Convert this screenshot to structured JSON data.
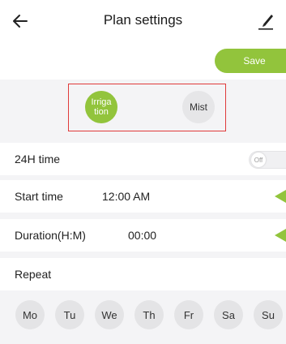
{
  "header": {
    "title": "Plan settings",
    "back_icon": "arrow-left-icon",
    "edit_icon": "pencil-icon"
  },
  "save": {
    "label": "Save"
  },
  "modes": {
    "items": [
      {
        "label": "Irriga\ntion",
        "selected": true
      },
      {
        "label": "Mist",
        "selected": false
      }
    ]
  },
  "settings": {
    "time24": {
      "label": "24H time",
      "toggle_text": "Off"
    },
    "start_time": {
      "label": "Start time",
      "value": "12:00 AM"
    },
    "duration": {
      "label": "Duration(H:M)",
      "value": "00:00"
    },
    "repeat": {
      "label": "Repeat"
    }
  },
  "days": [
    "Mo",
    "Tu",
    "We",
    "Th",
    "Fr",
    "Sa",
    "Su"
  ],
  "colors": {
    "accent": "#92c43c",
    "highlight_border": "#e03a3a",
    "background": "#f4f4f6"
  }
}
